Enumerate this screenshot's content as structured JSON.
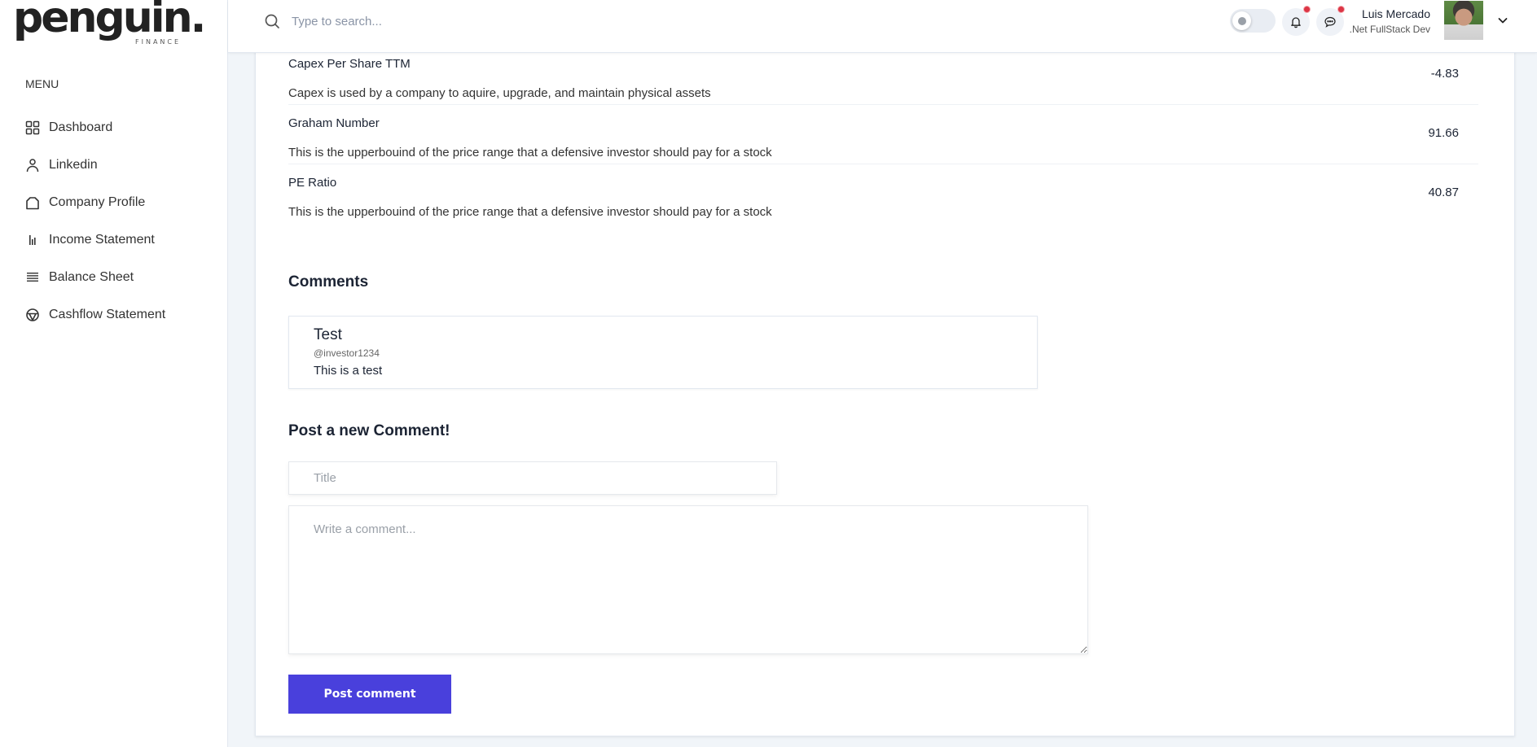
{
  "brand": {
    "name": "penguin.",
    "subtitle": "FINANCE"
  },
  "sidebar": {
    "menu_label": "MENU",
    "items": [
      {
        "label": "Dashboard",
        "icon": "grid-icon"
      },
      {
        "label": "Linkedin",
        "icon": "user-icon"
      },
      {
        "label": "Company Profile",
        "icon": "bag-icon"
      },
      {
        "label": "Income Statement",
        "icon": "bar-chart-icon"
      },
      {
        "label": "Balance Sheet",
        "icon": "list-icon"
      },
      {
        "label": "Cashflow Statement",
        "icon": "globe-icon"
      }
    ]
  },
  "header": {
    "search_placeholder": "Type to search...",
    "user_name": "Luis Mercado",
    "user_role": ".Net FullStack Dev",
    "notification_color": "#dc3545"
  },
  "metrics": [
    {
      "title": "Capex Per Share TTM",
      "description": "Capex is used by a company to aquire, upgrade, and maintain physical assets",
      "value": "-4.83"
    },
    {
      "title": "Graham Number",
      "description": "This is the upperbouind of the price range that a defensive investor should pay for a stock",
      "value": "91.66"
    },
    {
      "title": "PE Ratio",
      "description": "This is the upperbouind of the price range that a defensive investor should pay for a stock",
      "value": "40.87"
    }
  ],
  "comments": {
    "heading": "Comments",
    "items": [
      {
        "title": "Test",
        "username": "@investor1234",
        "body": "This is a test"
      }
    ]
  },
  "new_comment": {
    "heading": "Post a new Comment!",
    "title_placeholder": "Title",
    "title_value": "",
    "body_placeholder": "Write a comment...",
    "body_value": "",
    "submit_label": "Post comment",
    "accent_color": "#4940dc"
  }
}
